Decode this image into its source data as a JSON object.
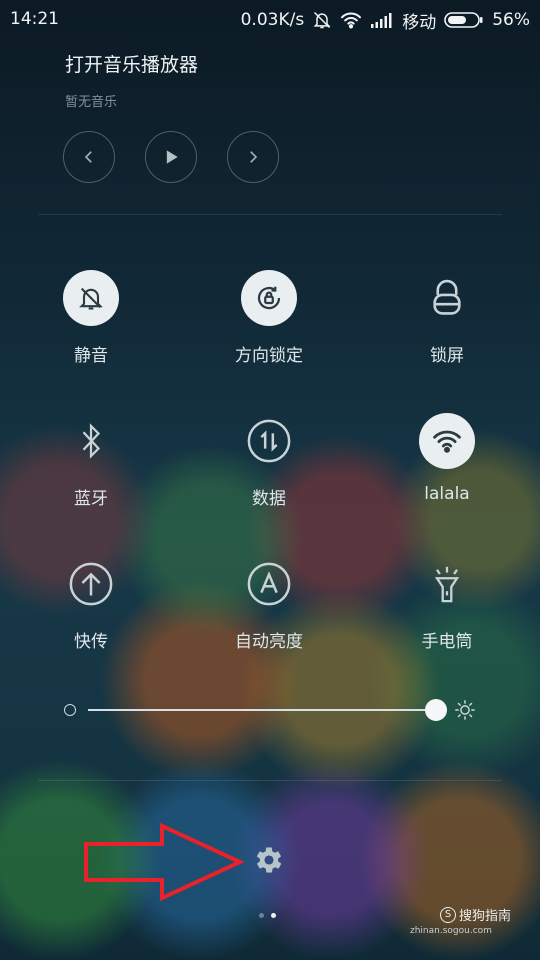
{
  "status_bar": {
    "time": "14:21",
    "speed": "0.03K/s",
    "carrier": "移动",
    "battery": "56%",
    "icons": [
      "mute-bell-icon",
      "wifi-icon",
      "signal-icon",
      "battery-icon"
    ]
  },
  "music": {
    "title": "打开音乐播放器",
    "subtitle": "暂无音乐",
    "controls": [
      "previous-icon",
      "play-icon",
      "next-icon"
    ]
  },
  "toggles": [
    {
      "label": "静音",
      "icon": "mute-bell-icon",
      "active": true
    },
    {
      "label": "方向锁定",
      "icon": "rotation-lock-icon",
      "active": true
    },
    {
      "label": "锁屏",
      "icon": "padlock-icon",
      "active": false
    },
    {
      "label": "蓝牙",
      "icon": "bluetooth-icon",
      "active": false
    },
    {
      "label": "数据",
      "icon": "mobile-data-icon",
      "active": false
    },
    {
      "label": "lalala",
      "icon": "wifi-icon",
      "active": true
    },
    {
      "label": "快传",
      "icon": "quick-transfer-icon",
      "active": false
    },
    {
      "label": "自动亮度",
      "icon": "auto-brightness-icon",
      "active": false
    },
    {
      "label": "手电筒",
      "icon": "flashlight-icon",
      "active": false
    }
  ],
  "brightness": {
    "level": 1.0
  },
  "pager": {
    "pages": 2,
    "current": 2
  },
  "watermark": {
    "text": "搜狗指南",
    "url": "zhinan.sogou.com"
  },
  "annotation": {
    "color": "#e8222a"
  },
  "colors": {
    "toggle_on_bg": "#e9eef0",
    "toggle_on_icon": "#2c3a42"
  }
}
